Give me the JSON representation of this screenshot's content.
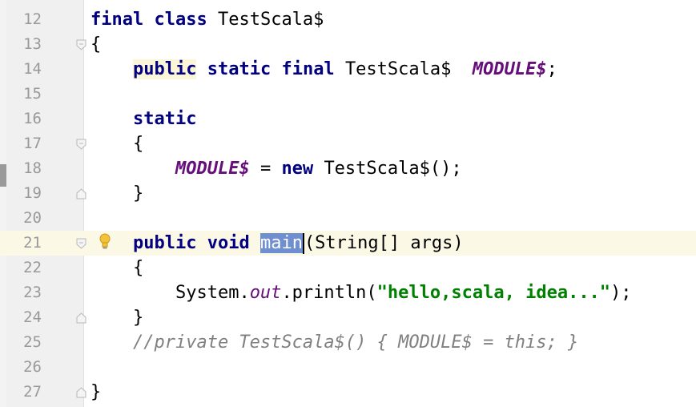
{
  "editor": {
    "lines": [
      {
        "num": "12"
      },
      {
        "num": "13"
      },
      {
        "num": "14"
      },
      {
        "num": "15"
      },
      {
        "num": "16"
      },
      {
        "num": "17"
      },
      {
        "num": "18"
      },
      {
        "num": "19"
      },
      {
        "num": "20"
      },
      {
        "num": "21"
      },
      {
        "num": "22"
      },
      {
        "num": "23"
      },
      {
        "num": "24"
      },
      {
        "num": "25"
      },
      {
        "num": "26"
      },
      {
        "num": "27"
      }
    ],
    "l12": {
      "kw1": "final",
      "kw2": "class",
      "name": "TestScala$"
    },
    "l13": {
      "brace": "{"
    },
    "l14": {
      "kw1": "public",
      "kw2": "static",
      "kw3": "final",
      "type": "TestScala$",
      "field": "MODULE$",
      "semi": ";"
    },
    "l16": {
      "kw": "static"
    },
    "l17": {
      "brace": "{"
    },
    "l18": {
      "field": "MODULE$",
      "assign": "=",
      "kw": "new",
      "ctor": "TestScala$();"
    },
    "l19": {
      "brace": "}"
    },
    "l21": {
      "kw1": "public",
      "kw2": "void",
      "method": "main",
      "params": "(String[] args)"
    },
    "l22": {
      "brace": "{"
    },
    "l23": {
      "recv": "System.",
      "field": "out",
      "call": ".println(",
      "str": "\"hello,scala, idea...\"",
      "end": ");"
    },
    "l24": {
      "brace": "}"
    },
    "l25": {
      "comment": "//private TestScala$() { MODULE$ = this; }"
    },
    "l27": {
      "brace": "}"
    }
  },
  "colors": {
    "keyword": "#000080",
    "field": "#660e7a",
    "string": "#008000",
    "comment": "#808080",
    "selection": "#6f8fd0",
    "current_line": "#fcf8e6"
  },
  "icons": {
    "fold": "fold-marker-icon",
    "bulb": "lightbulb-icon"
  }
}
